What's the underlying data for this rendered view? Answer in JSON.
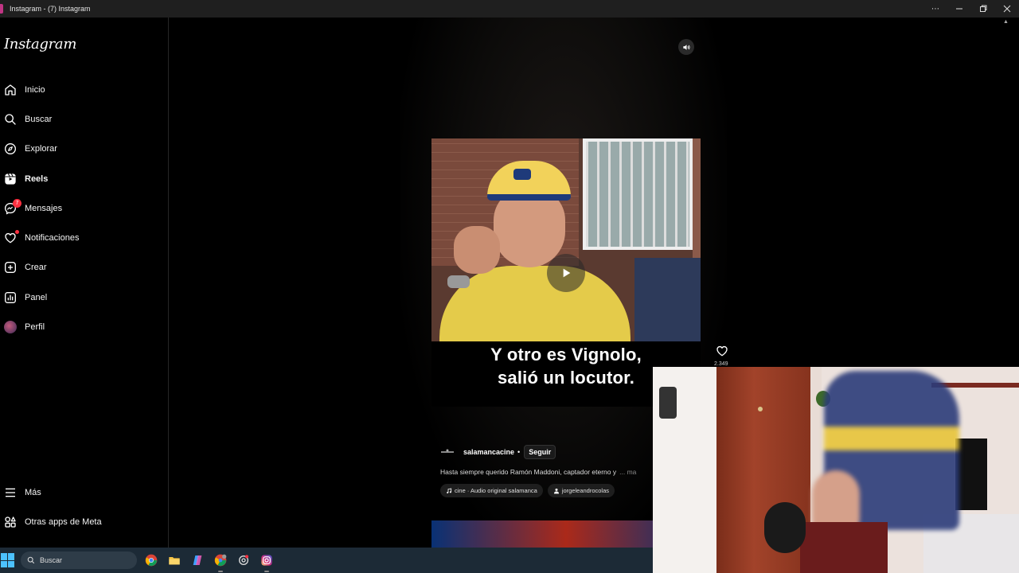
{
  "window": {
    "title": "Instagram - (7) Instagram",
    "controls": [
      "more",
      "minimize",
      "restore",
      "close"
    ]
  },
  "sidebar": {
    "logo": "Instagram",
    "items": [
      {
        "label": "Inicio",
        "icon": "home-icon"
      },
      {
        "label": "Buscar",
        "icon": "search-icon"
      },
      {
        "label": "Explorar",
        "icon": "compass-icon"
      },
      {
        "label": "Reels",
        "icon": "reels-icon",
        "active": true
      },
      {
        "label": "Mensajes",
        "icon": "messenger-icon",
        "badge": "7"
      },
      {
        "label": "Notificaciones",
        "icon": "heart-icon",
        "dot": true
      },
      {
        "label": "Crear",
        "icon": "plus-square-icon"
      },
      {
        "label": "Panel",
        "icon": "chart-icon"
      },
      {
        "label": "Perfil",
        "icon": "avatar"
      }
    ],
    "bottom": [
      {
        "label": "Más",
        "icon": "menu-icon"
      },
      {
        "label": "Otras apps de Meta",
        "icon": "apps-icon"
      }
    ]
  },
  "reel": {
    "subtitle_line1": "Y otro es Vignolo,",
    "subtitle_line2": "salió un locutor.",
    "likes": "2.349",
    "author": "salamancacine",
    "separator": "•",
    "follow_label": "Seguir",
    "caption": "Hasta siempre querido Ramón Maddoni, captador eterno y",
    "caption_more": "... ma",
    "audio_chip": "cine · Audio original  salamanca",
    "tag_chip": "jorgeleandrocolas"
  },
  "taskbar": {
    "search_label": "Buscar",
    "apps": [
      "chrome-icon",
      "file-explorer-icon",
      "copilot-icon",
      "chrome-profile-icon",
      "chatgpt-icon",
      "instagram-icon"
    ]
  },
  "colors": {
    "accent_red": "#ff3040",
    "background": "#000000",
    "taskbar": "#1c2a36"
  }
}
